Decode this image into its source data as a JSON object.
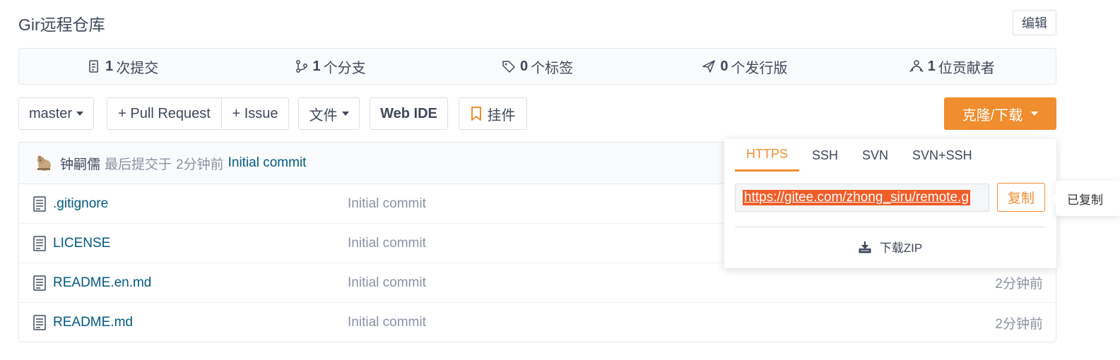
{
  "repo": {
    "title": "Gir远程仓库",
    "edit_label": "编辑"
  },
  "stats": [
    {
      "icon": "commits-icon",
      "count": "1",
      "label": "次提交"
    },
    {
      "icon": "branch-icon",
      "count": "1",
      "label": "个分支"
    },
    {
      "icon": "tag-icon",
      "count": "0",
      "label": "个标签"
    },
    {
      "icon": "release-icon",
      "count": "0",
      "label": "个发行版"
    },
    {
      "icon": "contributors-icon",
      "count": "1",
      "label": "位贡献者"
    }
  ],
  "toolbar": {
    "branch": "master",
    "pull_request": "+ Pull Request",
    "issue": "+ Issue",
    "files": "文件",
    "web_ide": "Web IDE",
    "widget": "挂件",
    "clone": "克隆/下载"
  },
  "latest_commit": {
    "author": "钟嗣儒",
    "prefix": "最后提交于",
    "time": "2分钟前",
    "message": "Initial commit"
  },
  "files": [
    {
      "name": ".gitignore",
      "message": "Initial commit",
      "time": ""
    },
    {
      "name": "LICENSE",
      "message": "Initial commit",
      "time": ""
    },
    {
      "name": "README.en.md",
      "message": "Initial commit",
      "time": "2分钟前"
    },
    {
      "name": "README.md",
      "message": "Initial commit",
      "time": "2分钟前"
    }
  ],
  "clone_dropdown": {
    "tabs": [
      "HTTPS",
      "SSH",
      "SVN",
      "SVN+SSH"
    ],
    "active_tab": "HTTPS",
    "url": "https://gitee.com/zhong_siru/remote.g",
    "copy_label": "复制",
    "zip_label": "下载ZIP"
  },
  "tooltip": {
    "text": "已复制"
  },
  "colors": {
    "accent": "#f08d2f",
    "link": "#005980",
    "muted": "#8c92a4",
    "selection": "#f05d29"
  }
}
